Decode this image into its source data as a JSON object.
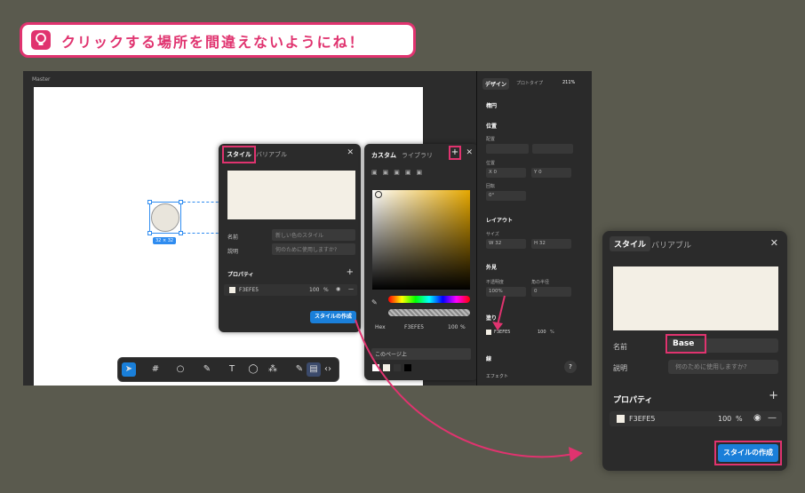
{
  "tip": {
    "text": "クリックする場所を間違えないようにね！",
    "icon": "lightbulb-icon"
  },
  "canvas": {
    "frame_label": "Master",
    "size_badge": "32 × 32"
  },
  "style_panel": {
    "tab_style": "スタイル",
    "tab_variable": "バリアブル",
    "name_label": "名前",
    "name_placeholder": "新しい色のスタイル",
    "desc_label": "説明",
    "desc_placeholder": "何のために使用しますか?",
    "props_label": "プロパティ",
    "color_hex": "F3EFE5",
    "opacity": "100",
    "percent": "%",
    "create_button": "スタイルの作成"
  },
  "color_panel": {
    "tab_custom": "カスタム",
    "tab_library": "ライブラリ",
    "format": "Hex",
    "hex": "F3EFE5",
    "opacity": "100",
    "percent": "%",
    "scope": "このページ上"
  },
  "right_panel": {
    "tab_design": "デザイン",
    "tab_prototype": "プロトタイプ",
    "zoom": "211%",
    "layer_name": "楕円",
    "position": "位置",
    "align": "配置",
    "pos_label": "位置",
    "x_label": "X",
    "x_val": "0",
    "y_label": "Y",
    "y_val": "0",
    "rotation_label": "回転",
    "rotation": "0°",
    "layout": "レイアウト",
    "size": "サイズ",
    "w_label": "W",
    "w_val": "32",
    "h_label": "H",
    "h_val": "32",
    "appearance": "外見",
    "opacity_label": "不透明度",
    "opacity_val": "100%",
    "radius_label": "角の半径",
    "radius_val": "0",
    "fill_label": "塗り",
    "fill_hex": "F3EFE5",
    "fill_opacity": "100",
    "fill_percent": "%",
    "stroke": "線",
    "effects": "エフェクト",
    "help": "?"
  },
  "zoom_panel": {
    "tab_style": "スタイル",
    "tab_variable": "バリアブル",
    "name_label": "名前",
    "name_value": "Base",
    "desc_label": "説明",
    "desc_placeholder": "何のために使用しますか?",
    "props_label": "プロパティ",
    "color_hex": "F3EFE5",
    "opacity": "100",
    "percent": "%",
    "create_button": "スタイルの作成"
  },
  "colors": {
    "accent": "#e0336f",
    "blue": "#1a7fd9",
    "swatch": "#f3efe5",
    "bg": "#5a5a4e"
  }
}
